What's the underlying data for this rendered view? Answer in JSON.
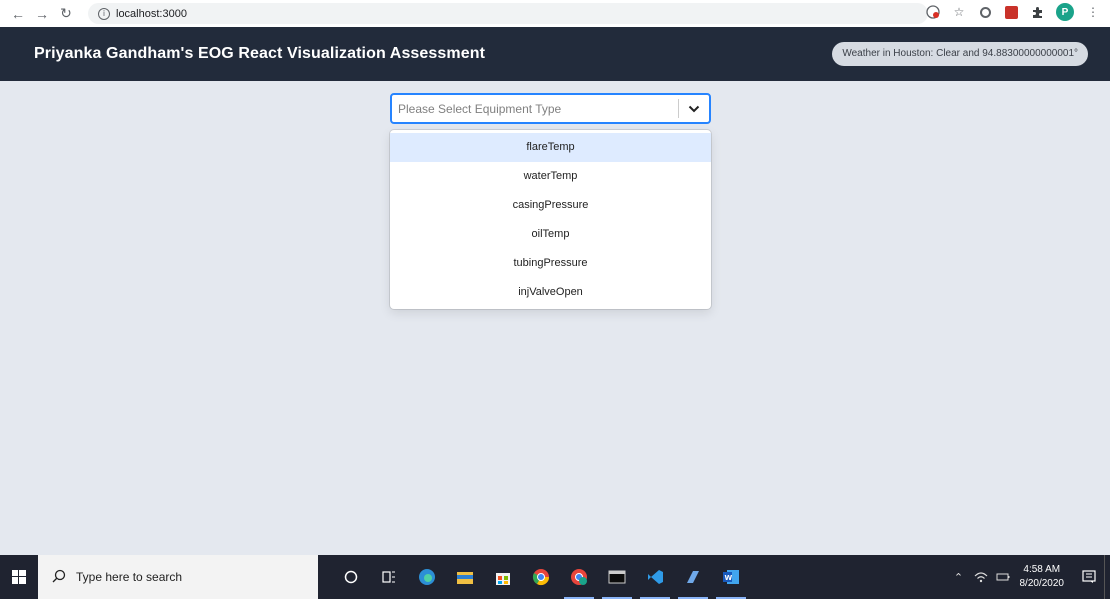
{
  "browser": {
    "url": "localhost:3000",
    "avatar_letter": "P",
    "icons": [
      "back-icon",
      "forward-icon",
      "reload-icon",
      "info-icon",
      "translate-icon",
      "star-icon",
      "circle-extension-icon",
      "rss-extension-icon",
      "puzzle-extensions-icon",
      "profile-avatar",
      "more-menu-icon"
    ]
  },
  "header": {
    "title": "Priyanka Gandham's EOG React Visualization Assessment",
    "weather": "Weather in Houston: Clear and 94.88300000000001°"
  },
  "select": {
    "placeholder": "Please Select Equipment Type",
    "options": [
      "flareTemp",
      "waterTemp",
      "casingPressure",
      "oilTemp",
      "tubingPressure",
      "injValveOpen"
    ],
    "focused_index": 0,
    "border_color": "#2684ff"
  },
  "taskbar": {
    "search_placeholder": "Type here to search",
    "time": "4:58 AM",
    "date": "8/20/2020",
    "apps": [
      "cortana-icon",
      "task-view-icon",
      "edge-icon",
      "file-explorer-icon",
      "store-icon",
      "chrome-icon",
      "chrome-profile-icon",
      "terminal-icon",
      "vscode-icon",
      "app-icon",
      "word-icon"
    ]
  },
  "colors": {
    "header_bg": "#222b3b",
    "page_bg": "#e4e8ef",
    "option_focus_bg": "#deebff",
    "taskbar_bg": "#1f2330"
  }
}
